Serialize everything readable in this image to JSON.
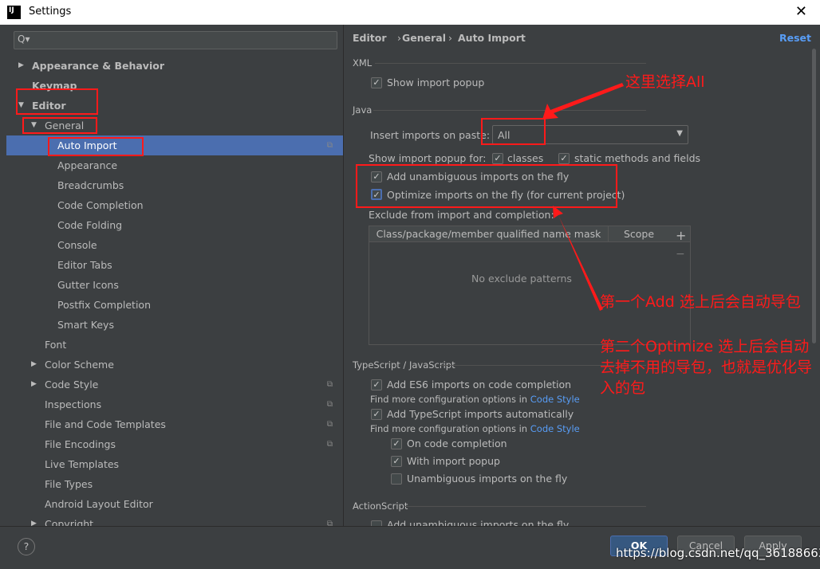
{
  "window": {
    "title": "Settings",
    "logo": "IJ",
    "close": "✕"
  },
  "search": {
    "placeholder": "Q▾"
  },
  "tree": [
    {
      "label": "Appearance & Behavior",
      "level": 0,
      "arrow": "▶",
      "bold": true
    },
    {
      "label": "Keymap",
      "level": 0,
      "bold": true
    },
    {
      "label": "Editor",
      "level": 0,
      "arrow": "▼",
      "bold": true
    },
    {
      "label": "General",
      "level": 1,
      "arrow": "▼"
    },
    {
      "label": "Auto Import",
      "level": 2,
      "selected": true,
      "copy": true
    },
    {
      "label": "Appearance",
      "level": 2
    },
    {
      "label": "Breadcrumbs",
      "level": 2
    },
    {
      "label": "Code Completion",
      "level": 2
    },
    {
      "label": "Code Folding",
      "level": 2
    },
    {
      "label": "Console",
      "level": 2
    },
    {
      "label": "Editor Tabs",
      "level": 2
    },
    {
      "label": "Gutter Icons",
      "level": 2
    },
    {
      "label": "Postfix Completion",
      "level": 2
    },
    {
      "label": "Smart Keys",
      "level": 2
    },
    {
      "label": "Font",
      "level": 1
    },
    {
      "label": "Color Scheme",
      "level": 1,
      "arrow": "▶"
    },
    {
      "label": "Code Style",
      "level": 1,
      "arrow": "▶",
      "copy": true
    },
    {
      "label": "Inspections",
      "level": 1,
      "copy": true
    },
    {
      "label": "File and Code Templates",
      "level": 1,
      "copy": true
    },
    {
      "label": "File Encodings",
      "level": 1,
      "copy": true
    },
    {
      "label": "Live Templates",
      "level": 1
    },
    {
      "label": "File Types",
      "level": 1
    },
    {
      "label": "Android Layout Editor",
      "level": 1
    },
    {
      "label": "Copyright",
      "level": 1,
      "arrow": "▶",
      "copy": true
    }
  ],
  "breadcrumb": {
    "a": "Editor",
    "b": "General",
    "c": "Auto Import",
    "sep": "›",
    "reset": "Reset"
  },
  "xml": {
    "header": "XML",
    "show_popup": "Show import popup"
  },
  "java": {
    "header": "Java",
    "insert_label": "Insert imports on paste:",
    "insert_value": "All",
    "popup_for": "Show import popup for:",
    "classes": "classes",
    "static": "static methods and fields",
    "add_unambiguous": "Add unambiguous imports on the fly",
    "optimize": "Optimize imports on the fly (for current project)",
    "exclude_label": "Exclude from import and completion:",
    "col1": "Class/package/member qualified name mask",
    "col2": "Scope",
    "empty": "No exclude patterns",
    "add": "+",
    "remove": "−"
  },
  "ts": {
    "header": "TypeScript / JavaScript",
    "es6": "Add ES6 imports on code completion",
    "find1": "Find more configuration options in ",
    "link": "Code Style",
    "ts_auto": "Add TypeScript imports automatically",
    "on_completion": "On code completion",
    "with_popup": "With import popup",
    "unambiguous": "Unambiguous imports on the fly"
  },
  "as": {
    "header": "ActionScript",
    "add": "Add unambiguous imports on the fly"
  },
  "footer": {
    "help": "?",
    "ok": "OK",
    "cancel": "Cancel",
    "apply": "Apply",
    "watermark": "https://blog.csdn.net/qq_36188663"
  },
  "annotations": {
    "select_all": "这里选择All",
    "note1": "第一个Add 选上后会自动导包",
    "note2": "第二个Optimize 选上后会自动去掉不用的导包，也就是优化导入的包"
  },
  "colors": {
    "selection": "#4b6eaf",
    "annotation": "#ff1a1a",
    "link": "#589df6"
  }
}
